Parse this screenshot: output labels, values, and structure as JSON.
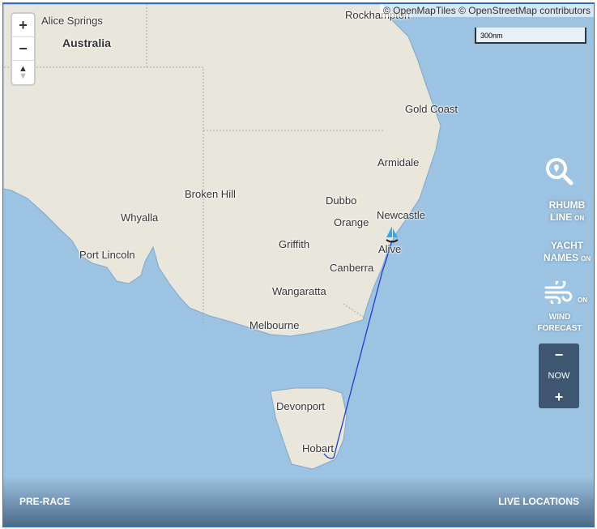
{
  "colors": {
    "sea": "#9cc3e1",
    "land": "#e9e7dc",
    "route": "#1f3bd6",
    "yacht": "#3aa7e0",
    "panel": "#3e5670"
  },
  "map_labels": {
    "alice_springs": "Alice Springs",
    "australia": "Australia",
    "rockhampton": "Rockhampton",
    "gold_coast": "Gold Coast",
    "armidale": "Armidale",
    "broken_hill": "Broken Hill",
    "dubbo": "Dubbo",
    "newcastle": "Newcastle",
    "orange": "Orange",
    "whyalla": "Whyalla",
    "griffith": "Griffith",
    "port_lincoln": "Port Lincoln",
    "canberra": "Canberra",
    "wangaratta": "Wangaratta",
    "melbourne": "Melbourne",
    "devonport": "Devonport",
    "hobart": "Hobart"
  },
  "yacht": {
    "name": "Alive",
    "icon": "yacht-icon"
  },
  "zoom": {
    "in": "+",
    "out": "−"
  },
  "attribution": "© OpenMapTiles © OpenStreetMap contributors",
  "scale": "300nm",
  "controls": {
    "rhumb": {
      "line1": "RHUMB",
      "line2": "LINE",
      "state": "ON",
      "icon": "search-pin-icon"
    },
    "names": {
      "line1": "YACHT",
      "line2": "NAMES",
      "state": "ON"
    },
    "wind": {
      "line1": "WIND",
      "line2": "FORECAST",
      "state": "ON",
      "icon": "wind-icon"
    },
    "time": {
      "minus": "−",
      "label": "NOW",
      "plus": "+"
    }
  },
  "bottom": {
    "left": "PRE-RACE",
    "right": "LIVE LOCATIONS"
  }
}
